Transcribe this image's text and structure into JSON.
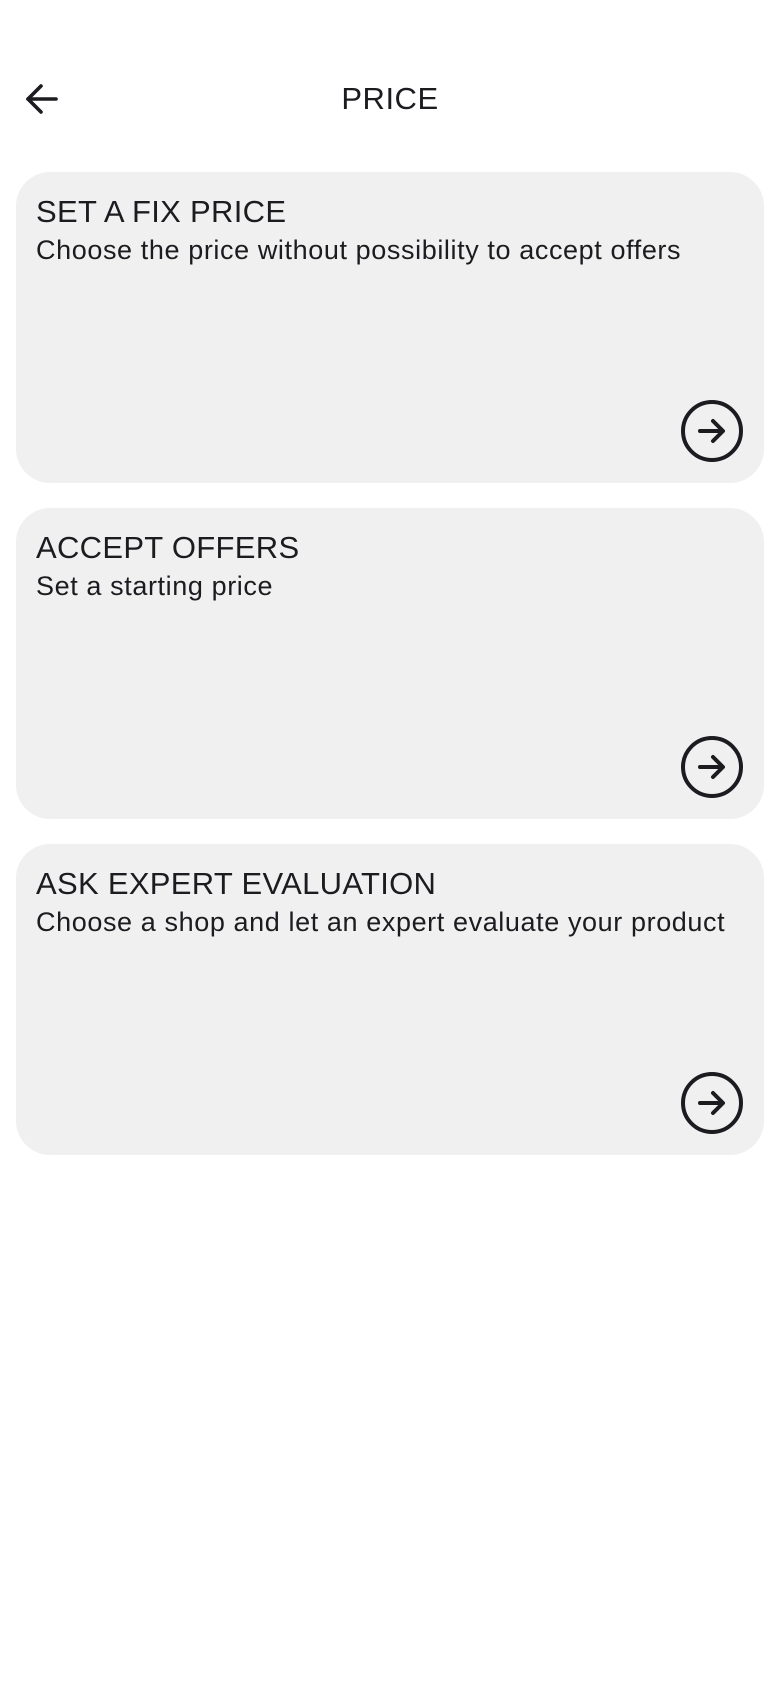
{
  "header": {
    "title": "PRICE",
    "back_icon": "arrow-left-icon"
  },
  "options": [
    {
      "title": "SET A FIX PRICE",
      "description": "Choose the price without possibility to accept offers",
      "icon": "arrow-right-circle-icon"
    },
    {
      "title": "ACCEPT OFFERS",
      "description": "Set a starting price",
      "icon": "arrow-right-circle-icon"
    },
    {
      "title": "ASK EXPERT EVALUATION",
      "description": "Choose a shop and let an expert evaluate your product",
      "icon": "arrow-right-circle-icon"
    }
  ],
  "colors": {
    "card_background": "#f0f0f0",
    "text": "#1c1b1f",
    "background": "#ffffff"
  }
}
